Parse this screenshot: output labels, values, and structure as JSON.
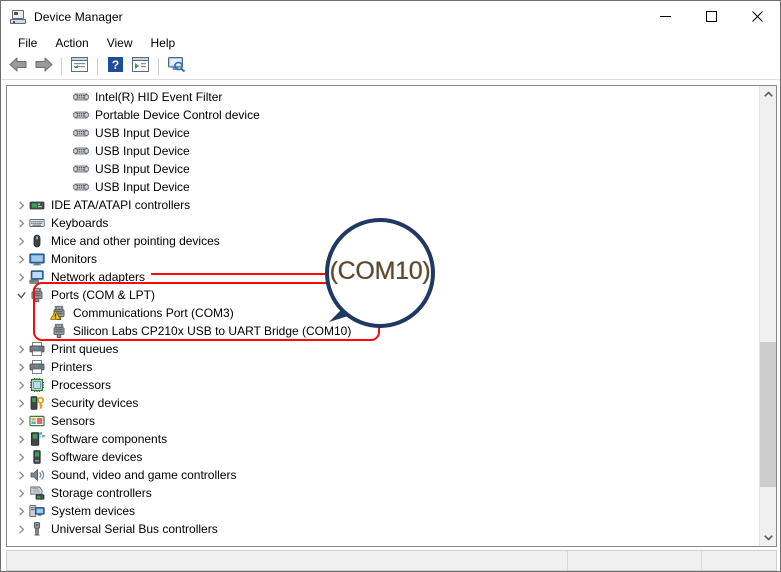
{
  "window": {
    "title": "Device Manager",
    "icon": "device-manager-icon",
    "controls": {
      "minimize": "minimize-icon",
      "maximize": "maximize-icon",
      "close": "close-icon"
    }
  },
  "menubar": {
    "items": [
      {
        "label": "File"
      },
      {
        "label": "Action"
      },
      {
        "label": "View"
      },
      {
        "label": "Help"
      }
    ]
  },
  "toolbar": {
    "buttons": [
      {
        "name": "back-arrow-icon",
        "tooltip": "Back"
      },
      {
        "name": "forward-arrow-icon",
        "tooltip": "Forward"
      },
      {
        "name": "separator-1"
      },
      {
        "name": "properties-icon",
        "tooltip": "Properties"
      },
      {
        "name": "separator-2"
      },
      {
        "name": "help-icon",
        "tooltip": "Help"
      },
      {
        "name": "update-driver-icon",
        "tooltip": "Update driver"
      },
      {
        "name": "separator-3"
      },
      {
        "name": "scan-hardware-changes-icon",
        "tooltip": "Scan for hardware changes"
      }
    ]
  },
  "tree": {
    "rows": [
      {
        "label": "Intel(R) HID Event Filter",
        "icon": "hid-device-icon",
        "level": 3,
        "expandable": false,
        "expanded": false,
        "warning": false
      },
      {
        "label": "Portable Device Control device",
        "icon": "hid-device-icon",
        "level": 3,
        "expandable": false,
        "expanded": false,
        "warning": false
      },
      {
        "label": "USB Input Device",
        "icon": "hid-device-icon",
        "level": 3,
        "expandable": false,
        "expanded": false,
        "warning": false
      },
      {
        "label": "USB Input Device",
        "icon": "hid-device-icon",
        "level": 3,
        "expandable": false,
        "expanded": false,
        "warning": false
      },
      {
        "label": "USB Input Device",
        "icon": "hid-device-icon",
        "level": 3,
        "expandable": false,
        "expanded": false,
        "warning": false
      },
      {
        "label": "USB Input Device",
        "icon": "hid-device-icon",
        "level": 3,
        "expandable": false,
        "expanded": false,
        "warning": false
      },
      {
        "label": "IDE ATA/ATAPI controllers",
        "icon": "ide-controller-icon",
        "level": 1,
        "expandable": true,
        "expanded": false,
        "warning": false
      },
      {
        "label": "Keyboards",
        "icon": "keyboard-icon",
        "level": 1,
        "expandable": true,
        "expanded": false,
        "warning": false
      },
      {
        "label": "Mice and other pointing devices",
        "icon": "mouse-icon",
        "level": 1,
        "expandable": true,
        "expanded": false,
        "warning": false
      },
      {
        "label": "Monitors",
        "icon": "monitor-icon",
        "level": 1,
        "expandable": true,
        "expanded": false,
        "warning": false
      },
      {
        "label": "Network adapters",
        "icon": "network-adapter-icon",
        "level": 1,
        "expandable": true,
        "expanded": false,
        "warning": false
      },
      {
        "label": "Ports (COM & LPT)",
        "icon": "port-icon",
        "level": 1,
        "expandable": true,
        "expanded": true,
        "warning": false
      },
      {
        "label": "Communications Port (COM3)",
        "icon": "port-icon",
        "level": 2,
        "expandable": false,
        "expanded": false,
        "warning": true
      },
      {
        "label": "Silicon Labs CP210x USB to UART Bridge (COM10)",
        "icon": "port-icon",
        "level": 2,
        "expandable": false,
        "expanded": false,
        "warning": false
      },
      {
        "label": "Print queues",
        "icon": "printer-icon",
        "level": 1,
        "expandable": true,
        "expanded": false,
        "warning": false
      },
      {
        "label": "Printers",
        "icon": "printer-icon",
        "level": 1,
        "expandable": true,
        "expanded": false,
        "warning": false
      },
      {
        "label": "Processors",
        "icon": "processor-icon",
        "level": 1,
        "expandable": true,
        "expanded": false,
        "warning": false
      },
      {
        "label": "Security devices",
        "icon": "security-device-icon",
        "level": 1,
        "expandable": true,
        "expanded": false,
        "warning": false
      },
      {
        "label": "Sensors",
        "icon": "sensor-icon",
        "level": 1,
        "expandable": true,
        "expanded": false,
        "warning": false
      },
      {
        "label": "Software components",
        "icon": "software-component-icon",
        "level": 1,
        "expandable": true,
        "expanded": false,
        "warning": false
      },
      {
        "label": "Software devices",
        "icon": "software-device-icon",
        "level": 1,
        "expandable": true,
        "expanded": false,
        "warning": false
      },
      {
        "label": "Sound, video and game controllers",
        "icon": "speaker-icon",
        "level": 1,
        "expandable": true,
        "expanded": false,
        "warning": false
      },
      {
        "label": "Storage controllers",
        "icon": "storage-controller-icon",
        "level": 1,
        "expandable": true,
        "expanded": false,
        "warning": false
      },
      {
        "label": "System devices",
        "icon": "system-device-icon",
        "level": 1,
        "expandable": true,
        "expanded": false,
        "warning": false
      },
      {
        "label": "Universal Serial Bus controllers",
        "icon": "usb-controller-icon",
        "level": 1,
        "expandable": true,
        "expanded": false,
        "warning": false
      }
    ]
  },
  "scrollbar": {
    "up_arrow": "scroll-up-icon",
    "down_arrow": "scroll-down-icon"
  },
  "annotation": {
    "magnifier_text": "(COM10)",
    "box_color": "#fb0a0a",
    "circle_color": "#1f3864"
  },
  "statusbar": {
    "panel1": "",
    "panel2": "",
    "panel3": ""
  }
}
